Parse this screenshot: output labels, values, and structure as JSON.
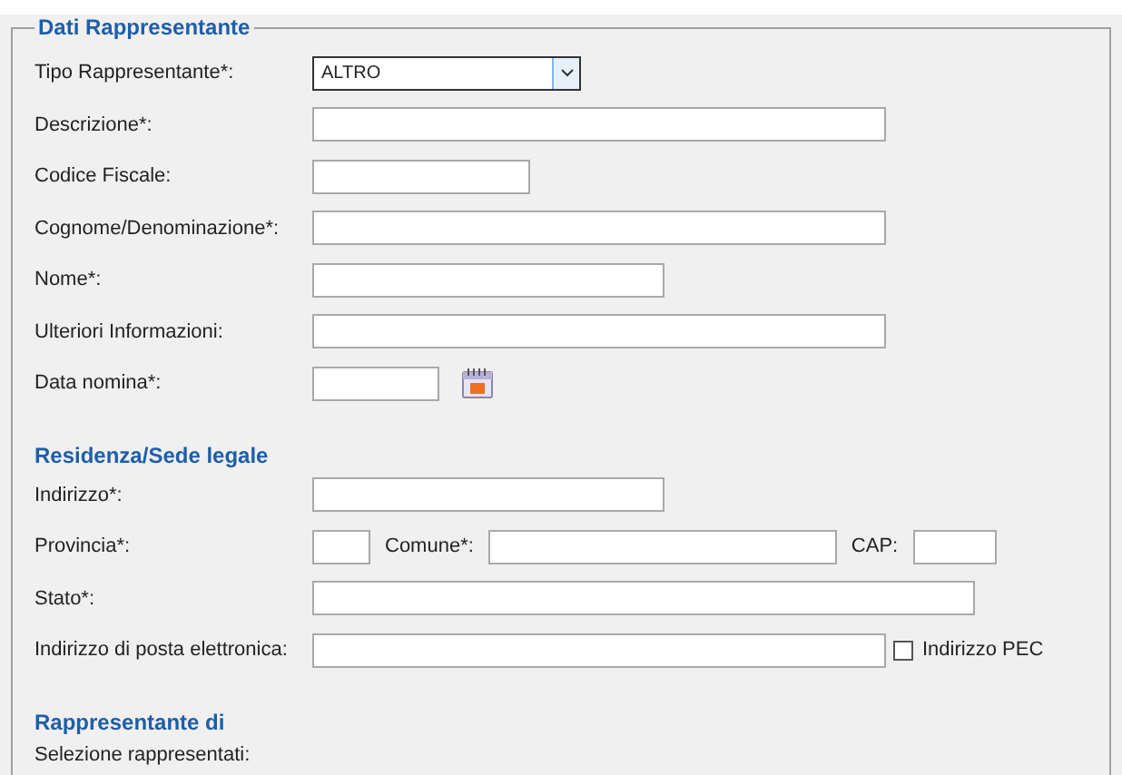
{
  "legend": "Dati Rappresentante",
  "sections": [
    {
      "rows": [
        {
          "label": "Tipo Rappresentante*:",
          "fields": [
            {
              "kind": "select",
              "value": "ALTRO"
            }
          ]
        },
        {
          "label": "Descrizione*:",
          "fields": [
            {
              "kind": "input"
            }
          ]
        },
        {
          "label": "Codice Fiscale:",
          "fields": [
            {
              "kind": "input"
            }
          ]
        },
        {
          "label": "Cognome/Denominazione*:",
          "fields": [
            {
              "kind": "input"
            }
          ]
        },
        {
          "label": "Nome*:",
          "fields": [
            {
              "kind": "input"
            }
          ]
        },
        {
          "label": "Ulteriori Informazioni:",
          "fields": [
            {
              "kind": "input"
            }
          ]
        },
        {
          "label": "Data nomina*:",
          "fields": [
            {
              "kind": "input"
            },
            {
              "kind": "calendar"
            }
          ]
        }
      ]
    },
    {
      "heading": "Residenza/Sede legale",
      "rows": [
        {
          "label": "Indirizzo*:",
          "fields": [
            {
              "kind": "input"
            }
          ]
        },
        {
          "label": "Provincia*:",
          "fields": [
            {
              "kind": "input"
            },
            {
              "kind": "label",
              "text": "Comune*:"
            },
            {
              "kind": "input"
            },
            {
              "kind": "label",
              "text": "CAP:"
            },
            {
              "kind": "input"
            }
          ]
        },
        {
          "label": "Stato*:",
          "fields": [
            {
              "kind": "input"
            }
          ]
        },
        {
          "label": "Indirizzo di posta elettronica:",
          "fields": [
            {
              "kind": "input"
            },
            {
              "kind": "checkbox",
              "text": "Indirizzo PEC",
              "checked": false
            }
          ]
        }
      ]
    },
    {
      "heading": "Rappresentante di",
      "rows": [
        {
          "label": "Selezione rappresentati:",
          "fields": []
        }
      ]
    }
  ]
}
